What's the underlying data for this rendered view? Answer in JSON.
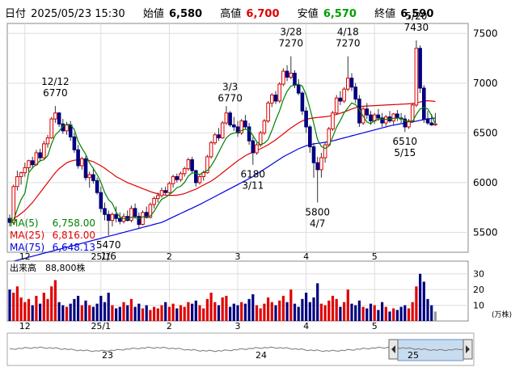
{
  "header": {
    "date_label": "日付",
    "datetime": "2025/05/23 15:30",
    "open_label": "始値",
    "open": "6,580",
    "high_label": "高値",
    "high": "6,700",
    "low_label": "安値",
    "low": "6,570",
    "close_label": "終値",
    "close": "6,590"
  },
  "colors": {
    "up": "#e00000",
    "down": "#000080",
    "ma5": "#008000",
    "ma25": "#e00000",
    "ma75": "#0000e0"
  },
  "chart_data": {
    "type": "candlestick",
    "ylim": [
      5300,
      7600
    ],
    "yticks": [
      5500,
      6000,
      6500,
      7000,
      7500
    ],
    "x_tick_labels": [
      {
        "label": "12",
        "index": 4
      },
      {
        "label": "25/1",
        "index": 24
      },
      {
        "label": "2",
        "index": 42
      },
      {
        "label": "3",
        "index": 60
      },
      {
        "label": "4",
        "index": 78
      },
      {
        "label": "5",
        "index": 96
      }
    ],
    "ma_legend": [
      {
        "name": "MA(5)",
        "value": "6,758.00"
      },
      {
        "name": "MA(25)",
        "value": "6,816.00"
      },
      {
        "name": "MA(75)",
        "value": "6,648.13"
      }
    ],
    "annotations": [
      {
        "date": "12/12",
        "price": "6770",
        "index": 12,
        "pos": "above"
      },
      {
        "date": "1/6",
        "price": "5470",
        "index": 26,
        "pos": "below"
      },
      {
        "date": "3/3",
        "price": "6770",
        "index": 58,
        "pos": "above"
      },
      {
        "date": "3/11",
        "price": "6180",
        "index": 64,
        "pos": "below"
      },
      {
        "date": "3/28",
        "price": "7270",
        "index": 74,
        "pos": "above"
      },
      {
        "date": "4/7",
        "price": "5800",
        "index": 81,
        "pos": "below"
      },
      {
        "date": "4/18",
        "price": "7270",
        "index": 89,
        "pos": "above"
      },
      {
        "date": "5/15",
        "price": "6510",
        "index": 104,
        "pos": "below"
      },
      {
        "date": "5/20",
        "price": "7430",
        "index": 107,
        "pos": "above"
      }
    ],
    "candles": [
      [
        5640,
        5680,
        5560,
        5600
      ],
      [
        5600,
        5980,
        5590,
        5960
      ],
      [
        5960,
        6120,
        5920,
        6060
      ],
      [
        6060,
        6110,
        5980,
        6100
      ],
      [
        6100,
        6200,
        6060,
        6150
      ],
      [
        6150,
        6230,
        6110,
        6220
      ],
      [
        6220,
        6260,
        6140,
        6180
      ],
      [
        6180,
        6330,
        6170,
        6300
      ],
      [
        6300,
        6340,
        6210,
        6250
      ],
      [
        6250,
        6420,
        6240,
        6390
      ],
      [
        6390,
        6480,
        6350,
        6450
      ],
      [
        6450,
        6660,
        6440,
        6640
      ],
      [
        6640,
        6770,
        6600,
        6700
      ],
      [
        6700,
        6710,
        6560,
        6590
      ],
      [
        6590,
        6640,
        6490,
        6520
      ],
      [
        6520,
        6610,
        6480,
        6580
      ],
      [
        6580,
        6620,
        6420,
        6460
      ],
      [
        6460,
        6500,
        6300,
        6330
      ],
      [
        6330,
        6380,
        6140,
        6170
      ],
      [
        6170,
        6260,
        6130,
        6240
      ],
      [
        6240,
        6270,
        6020,
        6050
      ],
      [
        6050,
        6110,
        5950,
        6080
      ],
      [
        6080,
        6150,
        5990,
        6020
      ],
      [
        6020,
        6050,
        5880,
        5900
      ],
      [
        5900,
        5960,
        5700,
        5740
      ],
      [
        5740,
        5800,
        5620,
        5680
      ],
      [
        5680,
        5720,
        5470,
        5620
      ],
      [
        5620,
        5700,
        5560,
        5680
      ],
      [
        5680,
        5760,
        5600,
        5640
      ],
      [
        5640,
        5700,
        5580,
        5610
      ],
      [
        5610,
        5690,
        5590,
        5660
      ],
      [
        5660,
        5720,
        5610,
        5620
      ],
      [
        5620,
        5770,
        5600,
        5740
      ],
      [
        5740,
        5790,
        5640,
        5660
      ],
      [
        5660,
        5700,
        5540,
        5580
      ],
      [
        5580,
        5720,
        5570,
        5700
      ],
      [
        5700,
        5760,
        5640,
        5650
      ],
      [
        5650,
        5800,
        5640,
        5780
      ],
      [
        5780,
        5860,
        5740,
        5840
      ],
      [
        5840,
        5900,
        5800,
        5870
      ],
      [
        5870,
        5950,
        5850,
        5920
      ],
      [
        5920,
        5960,
        5880,
        5900
      ],
      [
        5900,
        6010,
        5890,
        5990
      ],
      [
        5990,
        6080,
        5950,
        6060
      ],
      [
        6060,
        6090,
        6000,
        6030
      ],
      [
        6030,
        6110,
        6010,
        6090
      ],
      [
        6090,
        6160,
        6060,
        6140
      ],
      [
        6140,
        6250,
        6120,
        6230
      ],
      [
        6230,
        6260,
        6100,
        6120
      ],
      [
        6120,
        6130,
        5960,
        6000
      ],
      [
        6000,
        6080,
        5980,
        6060
      ],
      [
        6060,
        6120,
        6020,
        6100
      ],
      [
        6100,
        6280,
        6090,
        6260
      ],
      [
        6260,
        6420,
        6240,
        6400
      ],
      [
        6400,
        6500,
        6380,
        6480
      ],
      [
        6480,
        6550,
        6420,
        6450
      ],
      [
        6450,
        6620,
        6440,
        6600
      ],
      [
        6600,
        6770,
        6580,
        6700
      ],
      [
        6700,
        6720,
        6560,
        6580
      ],
      [
        6580,
        6660,
        6520,
        6560
      ],
      [
        6560,
        6620,
        6460,
        6500
      ],
      [
        6500,
        6640,
        6480,
        6620
      ],
      [
        6620,
        6680,
        6540,
        6560
      ],
      [
        6560,
        6600,
        6380,
        6420
      ],
      [
        6420,
        6460,
        6180,
        6300
      ],
      [
        6300,
        6400,
        6280,
        6380
      ],
      [
        6380,
        6520,
        6360,
        6500
      ],
      [
        6500,
        6640,
        6480,
        6620
      ],
      [
        6620,
        6820,
        6600,
        6800
      ],
      [
        6800,
        6900,
        6760,
        6880
      ],
      [
        6880,
        6920,
        6790,
        6820
      ],
      [
        6820,
        7010,
        6800,
        6990
      ],
      [
        6990,
        7150,
        6970,
        7120
      ],
      [
        7120,
        7180,
        7020,
        7060
      ],
      [
        7060,
        7270,
        7040,
        7100
      ],
      [
        7100,
        7130,
        6950,
        6980
      ],
      [
        6980,
        7040,
        6880,
        6900
      ],
      [
        6900,
        6920,
        6680,
        6720
      ],
      [
        6720,
        6760,
        6500,
        6560
      ],
      [
        6560,
        6580,
        6300,
        6360
      ],
      [
        6360,
        6400,
        6050,
        6200
      ],
      [
        6200,
        6260,
        5800,
        6130
      ],
      [
        6130,
        6300,
        6050,
        6250
      ],
      [
        6250,
        6400,
        6200,
        6380
      ],
      [
        6380,
        6560,
        6360,
        6540
      ],
      [
        6540,
        6720,
        6520,
        6700
      ],
      [
        6700,
        6880,
        6680,
        6850
      ],
      [
        6850,
        6920,
        6780,
        6820
      ],
      [
        6820,
        6960,
        6800,
        6940
      ],
      [
        6940,
        7270,
        6920,
        7050
      ],
      [
        7050,
        7100,
        6920,
        6960
      ],
      [
        6960,
        7000,
        6800,
        6840
      ],
      [
        6840,
        6880,
        6560,
        6600
      ],
      [
        6600,
        6760,
        6580,
        6740
      ],
      [
        6740,
        6800,
        6640,
        6680
      ],
      [
        6680,
        6720,
        6580,
        6620
      ],
      [
        6620,
        6700,
        6590,
        6680
      ],
      [
        6680,
        6740,
        6620,
        6650
      ],
      [
        6650,
        6700,
        6560,
        6600
      ],
      [
        6600,
        6680,
        6570,
        6660
      ],
      [
        6660,
        6720,
        6600,
        6620
      ],
      [
        6620,
        6700,
        6580,
        6690
      ],
      [
        6690,
        6730,
        6620,
        6650
      ],
      [
        6650,
        6700,
        6600,
        6640
      ],
      [
        6640,
        6680,
        6510,
        6560
      ],
      [
        6560,
        6640,
        6540,
        6620
      ],
      [
        6620,
        6800,
        6600,
        6780
      ],
      [
        6780,
        7430,
        6760,
        7350
      ],
      [
        7350,
        7380,
        6900,
        6950
      ],
      [
        6950,
        6980,
        6600,
        6640
      ],
      [
        6640,
        6720,
        6580,
        6600
      ],
      [
        6600,
        6690,
        6570,
        6580
      ],
      [
        6580,
        6700,
        6570,
        6590
      ]
    ],
    "ma5": [
      5640,
      5620,
      5733,
      5830,
      5894,
      6098,
      6150,
      6180,
      6220,
      6230,
      6272,
      6388,
      6480,
      6516,
      6568,
      6585,
      6583,
      6534,
      6416,
      6346,
      6285,
      6198,
      6142,
      6080,
      6004,
      5900,
      5829,
      5792,
      5704,
      5656,
      5640,
      5633,
      5652,
      5649,
      5636,
      5656,
      5659,
      5664,
      5711,
      5777,
      5833,
      5852,
      5880,
      5910,
      5949,
      5963,
      6002,
      6065,
      6098,
      6092,
      6080,
      6107,
      6121,
      6167,
      6231,
      6305,
      6380,
      6450,
      6484,
      6498,
      6506,
      6524,
      6537,
      6530,
      6474,
      6411,
      6382,
      6396,
      6434,
      6524,
      6629,
      6721,
      6835,
      6918,
      6971,
      6979,
      6990,
      6970,
      6884,
      6746,
      6596,
      6431,
      6365,
      6343,
      6368,
      6460,
      6557,
      6625,
      6702,
      6751,
      6801,
      6784,
      6734,
      6669,
      6609,
      6593,
      6625,
      6638,
      6639,
      6636,
      6640,
      6647,
      6649,
      6647,
      6620,
      6612,
      6614,
      6686,
      6741,
      6755,
      6741,
      6677,
      6590
    ],
    "ma25": [
      5640,
      5643,
      5660,
      5690,
      5720,
      5760,
      5800,
      5850,
      5900,
      5950,
      6000,
      6050,
      6100,
      6140,
      6170,
      6200,
      6215,
      6225,
      6230,
      6232,
      6230,
      6222,
      6210,
      6190,
      6170,
      6145,
      6115,
      6090,
      6060,
      6040,
      6020,
      6000,
      5985,
      5970,
      5955,
      5940,
      5925,
      5910,
      5897,
      5888,
      5880,
      5875,
      5872,
      5872,
      5874,
      5880,
      5890,
      5905,
      5920,
      5935,
      5955,
      5975,
      5995,
      6015,
      6040,
      6070,
      6100,
      6130,
      6160,
      6190,
      6220,
      6245,
      6270,
      6290,
      6305,
      6320,
      6340,
      6360,
      6380,
      6405,
      6430,
      6460,
      6490,
      6520,
      6550,
      6575,
      6600,
      6620,
      6635,
      6645,
      6650,
      6655,
      6658,
      6662,
      6668,
      6675,
      6685,
      6697,
      6710,
      6725,
      6740,
      6752,
      6762,
      6768,
      6770,
      6772,
      6774,
      6776,
      6778,
      6780,
      6782,
      6784,
      6786,
      6788,
      6790,
      6792,
      6795,
      6800,
      6810,
      6820,
      6823,
      6820,
      6816
    ],
    "ma75": [
      5200,
      5210,
      5220,
      5230,
      5240,
      5250,
      5260,
      5270,
      5280,
      5290,
      5300,
      5310,
      5320,
      5330,
      5340,
      5350,
      5360,
      5370,
      5380,
      5390,
      5400,
      5410,
      5420,
      5430,
      5440,
      5450,
      5460,
      5470,
      5480,
      5490,
      5500,
      5510,
      5520,
      5530,
      5540,
      5550,
      5560,
      5570,
      5580,
      5590,
      5600,
      5618,
      5636,
      5654,
      5672,
      5690,
      5708,
      5726,
      5744,
      5762,
      5780,
      5800,
      5820,
      5840,
      5860,
      5880,
      5900,
      5920,
      5940,
      5960,
      5980,
      6000,
      6020,
      6040,
      6060,
      6085,
      6110,
      6135,
      6160,
      6185,
      6210,
      6235,
      6260,
      6280,
      6300,
      6320,
      6340,
      6355,
      6370,
      6380,
      6390,
      6395,
      6400,
      6405,
      6410,
      6420,
      6430,
      6440,
      6450,
      6460,
      6470,
      6480,
      6490,
      6500,
      6510,
      6520,
      6530,
      6540,
      6550,
      6560,
      6570,
      6578,
      6585,
      6592,
      6598,
      6604,
      6610,
      6618,
      6626,
      6634,
      6640,
      6645,
      6648
    ],
    "volume_label": "出来高",
    "volume_value": "88,800株",
    "volume_unit": "(万株)",
    "volume_ylim": [
      0,
      35
    ],
    "volume_yticks": [
      10,
      20,
      30
    ],
    "volumes": [
      20,
      18,
      22,
      15,
      12,
      14,
      10,
      16,
      11,
      18,
      14,
      22,
      26,
      12,
      10,
      9,
      11,
      14,
      16,
      10,
      13,
      10,
      9,
      11,
      16,
      12,
      18,
      10,
      8,
      9,
      12,
      10,
      14,
      9,
      11,
      8,
      10,
      7,
      9,
      8,
      10,
      12,
      9,
      11,
      8,
      10,
      9,
      12,
      11,
      13,
      10,
      8,
      14,
      18,
      12,
      10,
      15,
      16,
      9,
      11,
      10,
      12,
      11,
      14,
      17,
      10,
      8,
      11,
      15,
      12,
      10,
      13,
      16,
      12,
      20,
      11,
      9,
      14,
      18,
      12,
      15,
      24,
      11,
      10,
      13,
      16,
      14,
      9,
      12,
      20,
      11,
      10,
      13,
      9,
      8,
      11,
      10,
      7,
      12,
      9,
      6,
      8,
      7,
      9,
      10,
      8,
      12,
      22,
      30,
      25,
      14,
      10,
      6
    ]
  },
  "navigator": {
    "labels": [
      {
        "label": "23",
        "x": 133
      },
      {
        "label": "24",
        "x": 323
      },
      {
        "label": "25",
        "x": 511
      }
    ]
  }
}
